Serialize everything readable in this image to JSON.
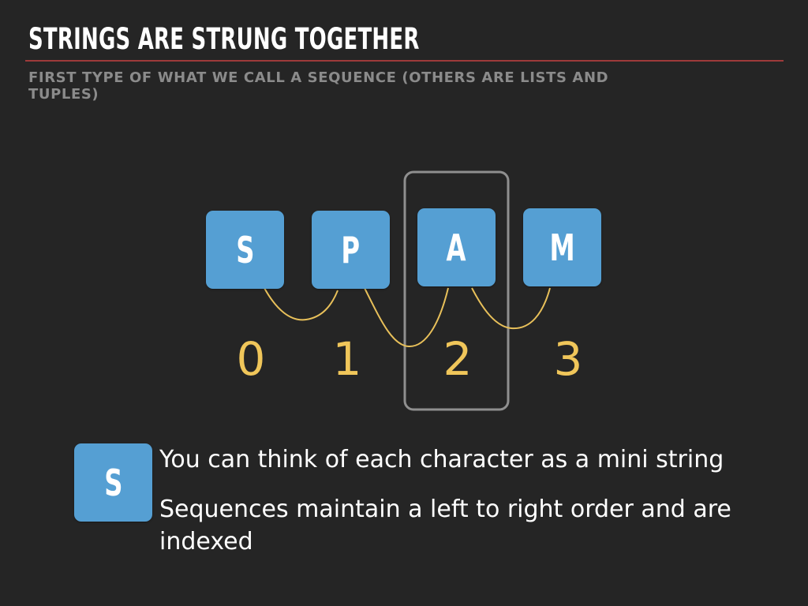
{
  "slide": {
    "title": "STRINGS ARE STRUNG TOGETHER",
    "subtitle": "FIRST TYPE OF WHAT WE CALL A SEQUENCE (OTHERS ARE LISTS AND TUPLES)"
  },
  "diagram": {
    "characters": [
      "S",
      "P",
      "A",
      "M"
    ],
    "indices": [
      "0",
      "1",
      "2",
      "3"
    ],
    "highlighted_index": 2
  },
  "example": {
    "character": "S"
  },
  "bullets": [
    "You can think of each character as a mini string",
    "Sequences maintain a left to right order and are indexed"
  ],
  "colors": {
    "background": "#252525",
    "title_rule": "#9e3a3a",
    "box_fill": "#559fd3",
    "connector": "#e8c05a",
    "index_text": "#f0c65a",
    "highlight_frame": "#8f8f8f"
  }
}
